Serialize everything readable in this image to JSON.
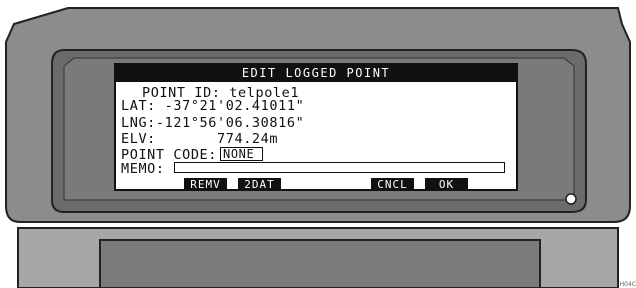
{
  "screen": {
    "title": "EDIT LOGGED POINT",
    "point_id_label": "POINT ID:",
    "point_id_value": "telpole1",
    "lat_label": "LAT:",
    "lat_value": "-37°21'02.41011\"",
    "lng_label": "LNG:",
    "lng_value": "-121°56'06.30816\"",
    "elv_label": "ELV:",
    "elv_value": "774.24m",
    "point_code_label": "POINT CODE:",
    "point_code_value": "NONE",
    "memo_label": "MEMO:",
    "memo_value": ""
  },
  "softkeys": {
    "remv": "REMV",
    "twodat": "2DAT",
    "cncl": "CNCL",
    "ok": "OK"
  },
  "figure_code": "H04C",
  "colors": {
    "bezel_outer": "#8a8a8a",
    "bezel_inner": "#6e6e6e",
    "screen_bg": "#ffffff",
    "ink": "#111111"
  }
}
